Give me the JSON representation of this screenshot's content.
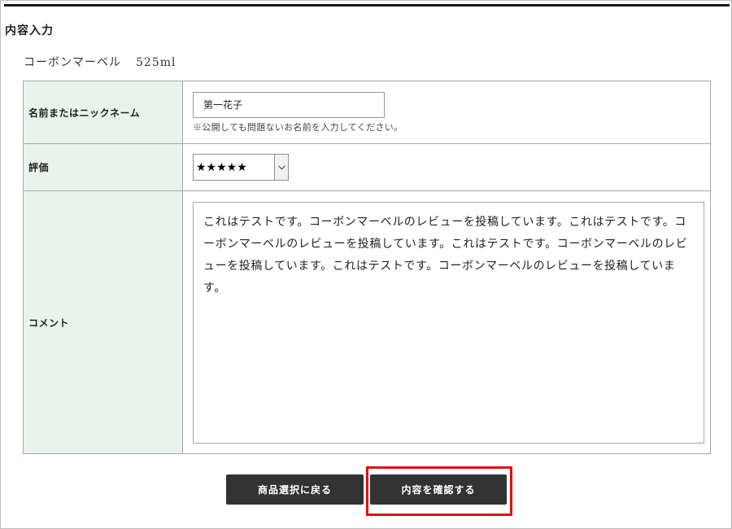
{
  "section": {
    "title": "内容入力"
  },
  "product": {
    "name": "コーボンマーベル",
    "volume": "525ml"
  },
  "form": {
    "name_label": "名前またはニックネーム",
    "name_value": "第一花子",
    "name_note": "※公開しても問題ないお名前を入力してください。",
    "rating_label": "評価",
    "rating_value": "★★★★★",
    "comment_label": "コメント",
    "comment_value": "これはテストです。コーボンマーベルのレビューを投稿しています。これはテストです。コーボンマーベルのレビューを投稿しています。これはテストです。コーボンマーベルのレビューを投稿しています。これはテストです。コーボンマーベルのレビューを投稿しています。"
  },
  "buttons": {
    "back_label": "商品選択に戻る",
    "confirm_label": "内容を確認する"
  },
  "colors": {
    "label_bg": "#e8f3ec",
    "button_bg": "#333333",
    "highlight": "#e01010"
  },
  "icons": {
    "select_arrow": "chevron-down-icon",
    "resize": "resize-handle-icon"
  }
}
